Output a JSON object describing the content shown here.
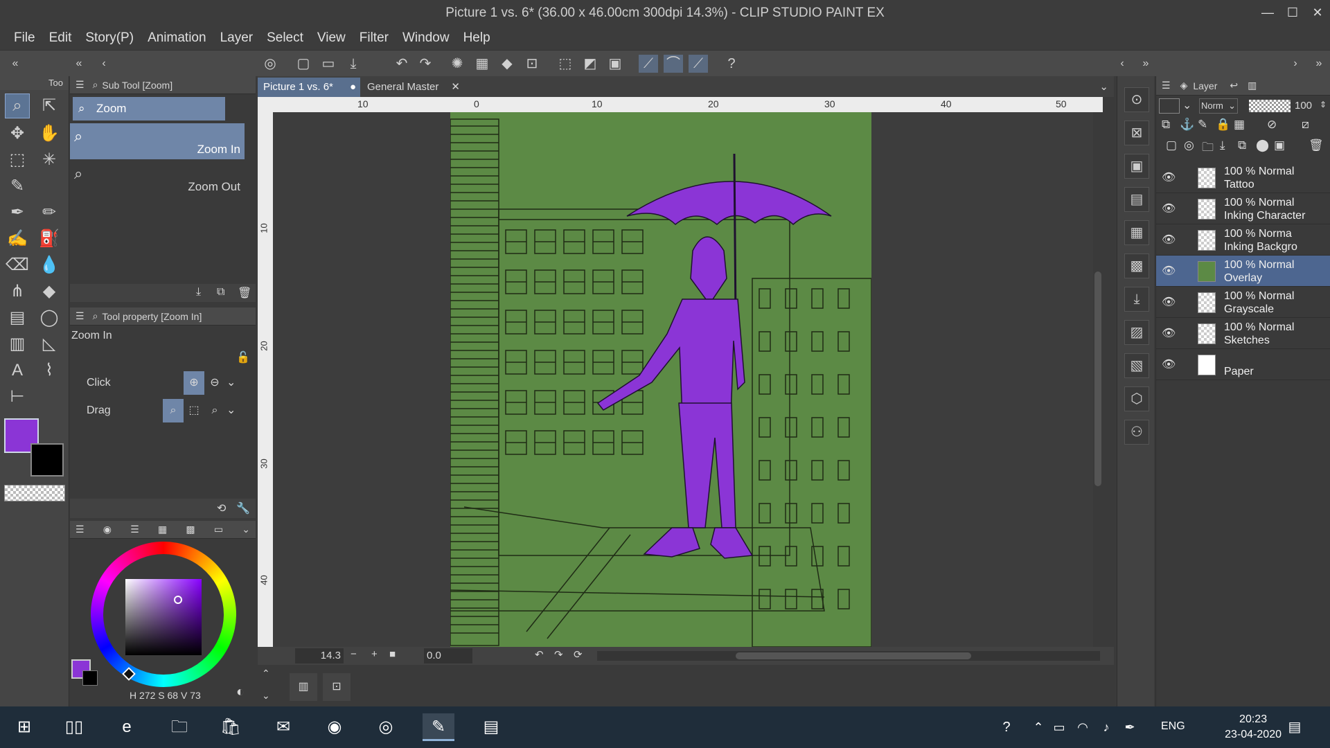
{
  "window": {
    "title": "Picture 1 vs. 6* (36.00 x 46.00cm 300dpi 14.3%) - CLIP STUDIO PAINT EX",
    "min_icon": "minimize-icon",
    "max_icon": "maximize-icon",
    "close_icon": "close-icon"
  },
  "menu": [
    "File",
    "Edit",
    "Story(P)",
    "Animation",
    "Layer",
    "Select",
    "View",
    "Filter",
    "Window",
    "Help"
  ],
  "subtool": {
    "panel_title": "Sub Tool [Zoom]",
    "group": "Zoom",
    "items": [
      {
        "label": "Zoom In"
      },
      {
        "label": "Zoom Out"
      }
    ]
  },
  "toolprop": {
    "panel_title": "Tool property [Zoom In]",
    "name": "Zoom In",
    "click_label": "Click",
    "drag_label": "Drag"
  },
  "tools_tab_label": "Too",
  "tabs": [
    {
      "label": "Picture 1 vs. 6*"
    },
    {
      "label": "General Master"
    }
  ],
  "ruler": {
    "top": [
      "10",
      "0",
      "10",
      "20",
      "30",
      "40",
      "50"
    ],
    "left": [
      "10",
      "20",
      "30",
      "40"
    ]
  },
  "canvas": {
    "zoom": "14.3",
    "rotation": "0.0",
    "background": "#5c8a45",
    "figure_color": "#8b35d6"
  },
  "color": {
    "main": "#8b35d6",
    "sub": "#000000",
    "hsv": {
      "h_label": "H",
      "h": "272",
      "s_label": "S",
      "s": "68",
      "v_label": "V",
      "v": "73"
    }
  },
  "layer_panel": {
    "title": "Layer",
    "blend_mode": "Norm",
    "opacity": "100",
    "layers": [
      {
        "line1": "100 % Normal",
        "line2": "Tattoo",
        "selected": false
      },
      {
        "line1": "100 % Normal",
        "line2": "Inking Character",
        "selected": false
      },
      {
        "line1": "100 % Norma",
        "line2": "Inking Backgro",
        "selected": false
      },
      {
        "line1": "100 % Normal",
        "line2": "Overlay",
        "selected": true
      },
      {
        "line1": "100 % Normal",
        "line2": "Grayscale",
        "selected": false
      },
      {
        "line1": "100 % Normal",
        "line2": "Sketches",
        "selected": false
      },
      {
        "line1": "",
        "line2": "Paper",
        "selected": false
      }
    ]
  },
  "taskbar": {
    "lang": "ENG",
    "time": "20:23",
    "date": "23-04-2020"
  }
}
